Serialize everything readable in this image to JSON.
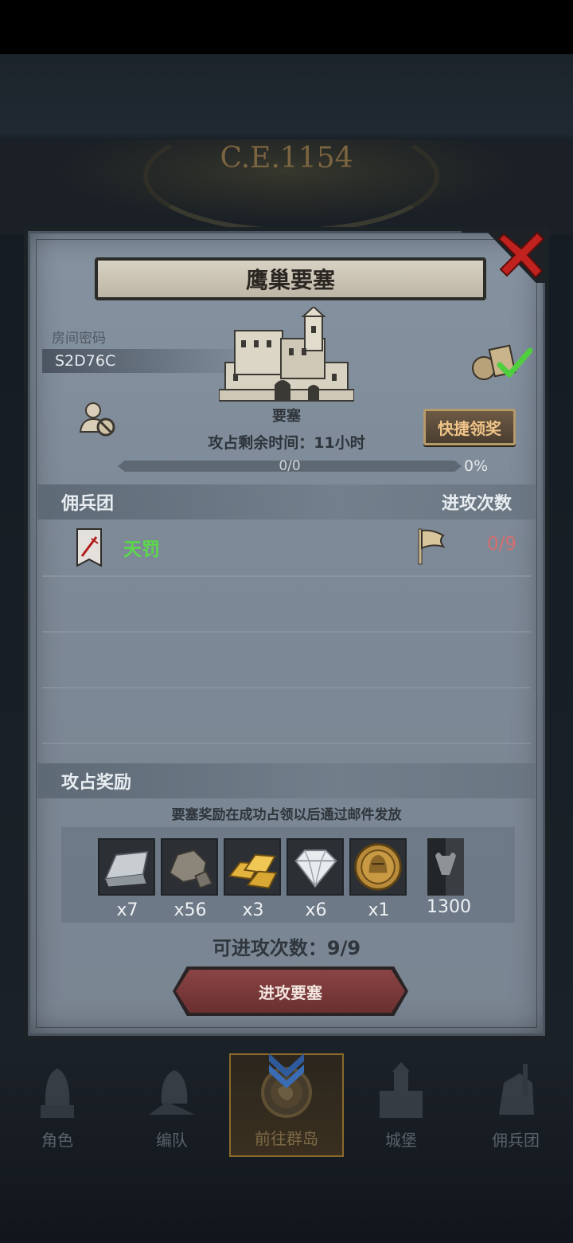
{
  "background": {
    "era_label": "C.E.1154"
  },
  "modal": {
    "title": "鹰巢要塞",
    "room_code_label": "房间密码",
    "room_code": "S2D76C",
    "fortress_name": "要塞",
    "remaining_label": "攻占剩余时间：",
    "remaining_value": "11小时",
    "progress": {
      "text": "0/0",
      "percent_text": "0%",
      "fraction": 0
    },
    "claim_button": "快捷领奖",
    "mercenary_header": "佣兵团",
    "attacks_header": "进攻次数",
    "mercenaries": [
      {
        "name": "天罚",
        "attacks": "0/9"
      }
    ],
    "reward_header": "攻占奖励",
    "reward_note": "要塞奖励在成功占领以后通过邮件发放",
    "rewards": [
      {
        "icon": "silver-ingot-icon",
        "qty": "x7"
      },
      {
        "icon": "stone-ore-icon",
        "qty": "x56"
      },
      {
        "icon": "gold-bars-icon",
        "qty": "x3"
      },
      {
        "icon": "diamond-icon",
        "qty": "x6"
      },
      {
        "icon": "knight-medal-icon",
        "qty": "x1"
      },
      {
        "icon": "bull-banner-icon",
        "qty": "1300"
      }
    ],
    "available_label": "可进攻次数：",
    "available_value": "9/9",
    "attack_button": "进攻要塞"
  },
  "nav": {
    "items": [
      {
        "label": "角色",
        "icon": "knight-helmet-icon"
      },
      {
        "label": "编队",
        "icon": "formation-icon"
      },
      {
        "label": "前往群岛",
        "icon": "compass-globe-icon",
        "active": true
      },
      {
        "label": "城堡",
        "icon": "castle-icon"
      },
      {
        "label": "佣兵团",
        "icon": "mercenary-icon"
      }
    ]
  },
  "colors": {
    "accent_green": "#5bd94a",
    "attacks_red": "#d46e70",
    "claim_text": "#f0c489",
    "attack_button": "#7a3a3a"
  }
}
